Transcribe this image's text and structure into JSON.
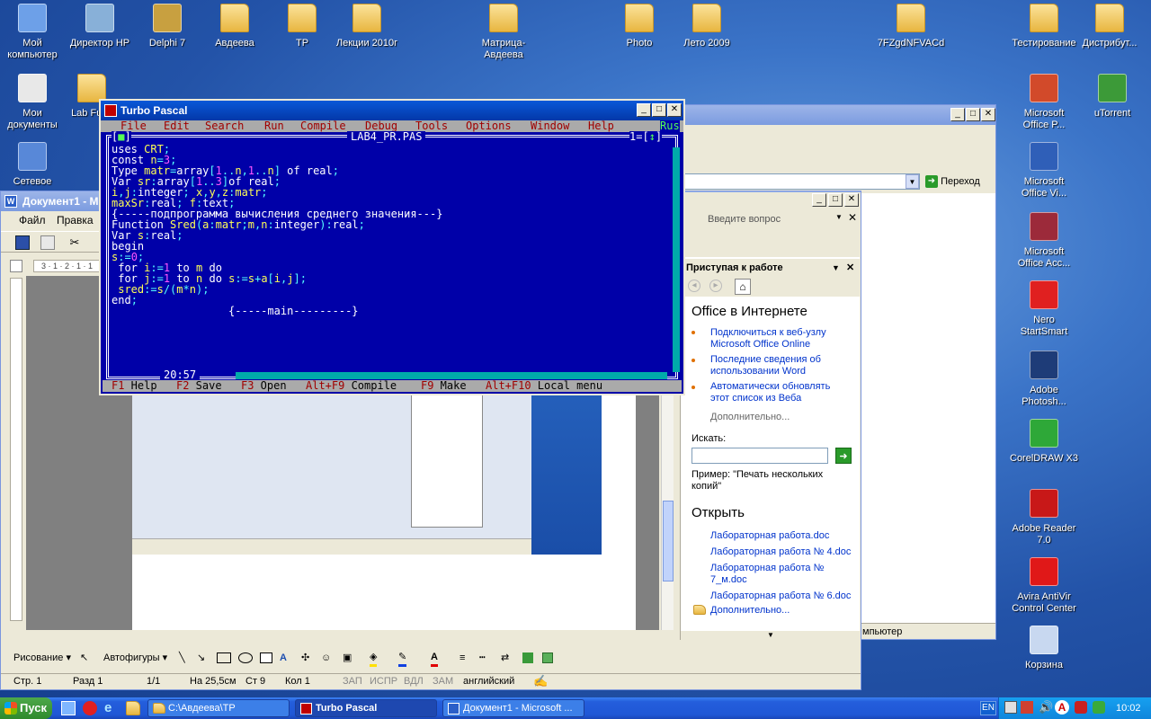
{
  "desktop": {
    "icons_top": [
      {
        "label": "Мой компьютер",
        "icon": "my-computer-icon"
      },
      {
        "label": "Директор HP",
        "icon": "hp-director-icon"
      },
      {
        "label": "Delphi 7",
        "icon": "delphi-icon"
      },
      {
        "label": "Авдеева",
        "icon": "folder-icon"
      },
      {
        "label": "ТР",
        "icon": "folder-icon"
      },
      {
        "label": "Лекции 2010г",
        "icon": "folder-icon"
      },
      {
        "label": "Матрица-Авдеева",
        "icon": "folder-icon"
      },
      {
        "label": "Photo",
        "icon": "folder-icon"
      },
      {
        "label": "Лето 2009",
        "icon": "folder-icon"
      },
      {
        "label": "7FZgdNFVACd",
        "icon": "folder-icon"
      },
      {
        "label": "Тестирование",
        "icon": "folder-icon"
      },
      {
        "label": "Дистрибут...",
        "icon": "folder-icon"
      }
    ],
    "icons_left": [
      {
        "label": "Мои документы",
        "icon": "my-documents-icon"
      },
      {
        "label": "Lab Func",
        "icon": "folder-icon"
      },
      {
        "label": "Сетевое",
        "icon": "network-icon"
      }
    ],
    "icons_right": [
      {
        "label": "Microsoft Office P...",
        "icon": "powerpoint-icon"
      },
      {
        "label": "uTorrent",
        "icon": "utorrent-icon"
      },
      {
        "label": "Microsoft Office Vi...",
        "icon": "visio-icon"
      },
      {
        "label": "Microsoft Office Acc...",
        "icon": "access-icon"
      },
      {
        "label": "Nero StartSmart",
        "icon": "nero-icon"
      },
      {
        "label": "Adobe Photosh...",
        "icon": "photoshop-icon"
      },
      {
        "label": "CorelDRAW X3",
        "icon": "coreldraw-icon"
      },
      {
        "label": "Adobe Reader 7.0",
        "icon": "adobe-reader-icon"
      },
      {
        "label": "Avira AntiVir Control Center",
        "icon": "avira-icon"
      },
      {
        "label": "Корзина",
        "icon": "recycle-bin-icon"
      }
    ]
  },
  "pascal": {
    "title": "Turbo Pascal",
    "menu": [
      "File",
      "Edit",
      "Search",
      "Run",
      "Compile",
      "Debug",
      "Tools",
      "Options",
      "Window",
      "Help"
    ],
    "lang": "Rus",
    "filename": "LAB4_PR.PAS",
    "window_num": "1",
    "position": "20:57",
    "code": [
      "uses CRT;",
      "const n=3;",
      "Type matr=array[1..n,1..n] of real;",
      "Var sr:array[1..3]of real;",
      "i,j:integer; x,y,z:matr;",
      "maxSr:real; f:text;",
      "{-----подпрограмма вычисления среднего значения---}",
      "Function Sred(a:matr;m,n:integer):real;",
      "Var s:real;",
      "begin",
      "s:=0;",
      " for i:=1 to m do",
      " for j:=1 to n do s:=s+a[i,j];",
      " sred:=s/(m*n);",
      "end;",
      "                  {-----main---------}"
    ],
    "fkeys": [
      {
        "key": "F1",
        "label": "Help"
      },
      {
        "key": "F2",
        "label": "Save"
      },
      {
        "key": "F3",
        "label": "Open"
      },
      {
        "key": "Alt+F9",
        "label": "Compile"
      },
      {
        "key": "F9",
        "label": "Make"
      },
      {
        "key": "Alt+F10",
        "label": "Local menu"
      }
    ]
  },
  "word": {
    "title": "Документ1 - M",
    "menu": [
      "Файл",
      "Правка"
    ],
    "ask_placeholder": "Введите вопрос",
    "goto_label": "Переход",
    "ruler": "3 · 1 · 2 · 1 · 1",
    "status": {
      "page": "Стр. 1",
      "section": "Разд 1",
      "pages": "1/1",
      "at": "На 25,5см",
      "line": "Ст 9",
      "col": "Кол 1",
      "rec": "ЗАП",
      "trk": "ИСПР",
      "ext": "ВДЛ",
      "ovr": "ЗАМ",
      "lang": "английский"
    },
    "drawing_label": "Рисование ▾",
    "autoshapes_label": "Автофигуры ▾"
  },
  "task_pane": {
    "title": "Приступая к работе",
    "office_online": "Office в Интернете",
    "links": [
      "Подключиться к веб-узлу Microsoft Office Online",
      "Последние сведения об использовании Word",
      "Автоматически обновлять этот список из Веба"
    ],
    "more": "Дополнительно...",
    "search_label": "Искать:",
    "example": "Пример: \"Печать нескольких копий\"",
    "open_title": "Открыть",
    "files": [
      "Лабораторная работа.doc",
      "Лабораторная работа № 4.doc",
      "Лабораторная работа № 7_м.doc",
      "Лабораторная работа № 6.doc"
    ],
    "more_files": "Дополнительно..."
  },
  "background_window": {
    "status_text": "мпьютер"
  },
  "taskbar": {
    "start": "Пуск",
    "tasks": [
      "C:\\Авдеева\\ТР",
      "Turbo Pascal",
      "Документ1 - Microsoft ..."
    ],
    "lang": "EN",
    "clock": "10:02"
  }
}
